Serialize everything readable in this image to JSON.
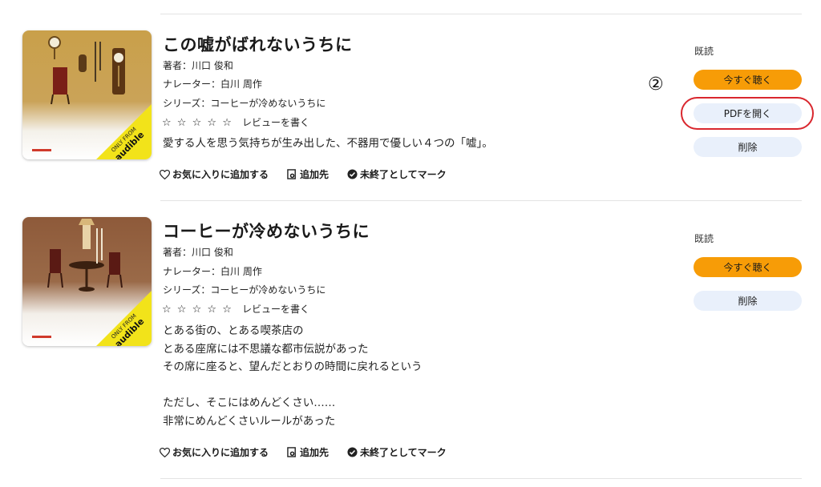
{
  "annotation": {
    "marker": "②"
  },
  "books": [
    {
      "title": "この嘘がばれないうちに",
      "author": "著者：川口 俊和",
      "narrator": "ナレーター：白川 周作",
      "series": "シリーズ：コーヒーが冷めないうちに",
      "stars": [
        "☆",
        "☆",
        "☆",
        "☆",
        "☆"
      ],
      "review_link": "レビューを書く",
      "description": [
        "愛する人を思う気持ちが生み出した、不器用で優しい４つの「嘘」。"
      ],
      "actions": {
        "favorite": "お気に入りに追加する",
        "add_to": "追加先",
        "mark": "未終了としてマーク"
      },
      "status": "既読",
      "buttons": {
        "listen": "今すぐ聴く",
        "pdf": "PDFを開く",
        "delete": "削除"
      },
      "cover": {
        "badge_top": "ONLY FROM",
        "badge_brand": "audible",
        "colors": {
          "bg": "#c49a3c",
          "badge": "#f2e31a"
        }
      }
    },
    {
      "title": "コーヒーが冷めないうちに",
      "author": "著者：川口 俊和",
      "narrator": "ナレーター：白川 周作",
      "series": "シリーズ：コーヒーが冷めないうちに",
      "stars": [
        "☆",
        "☆",
        "☆",
        "☆",
        "☆"
      ],
      "review_link": "レビューを書く",
      "description": [
        "とある街の、とある喫茶店の",
        "とある座席には不思議な都市伝説があった",
        "その席に座ると、望んだとおりの時間に戻れるという",
        "",
        "ただし、そこにはめんどくさい……",
        "非常にめんどくさいルールがあった"
      ],
      "actions": {
        "favorite": "お気に入りに追加する",
        "add_to": "追加先",
        "mark": "未終了としてマーク"
      },
      "status": "既読",
      "buttons": {
        "listen": "今すぐ聴く",
        "delete": "削除"
      },
      "cover": {
        "badge_top": "ONLY FROM",
        "badge_brand": "audible",
        "colors": {
          "bg": "#8a5a3c",
          "badge": "#f2e31a"
        }
      }
    }
  ],
  "colors": {
    "primary_button": "#f79c07",
    "secondary_button": "#e9f0fb",
    "highlight": "#d9272e"
  },
  "icons": {
    "favorite": "heart-outline-icon",
    "add_to": "add-to-collection-icon",
    "mark": "check-circle-icon"
  }
}
